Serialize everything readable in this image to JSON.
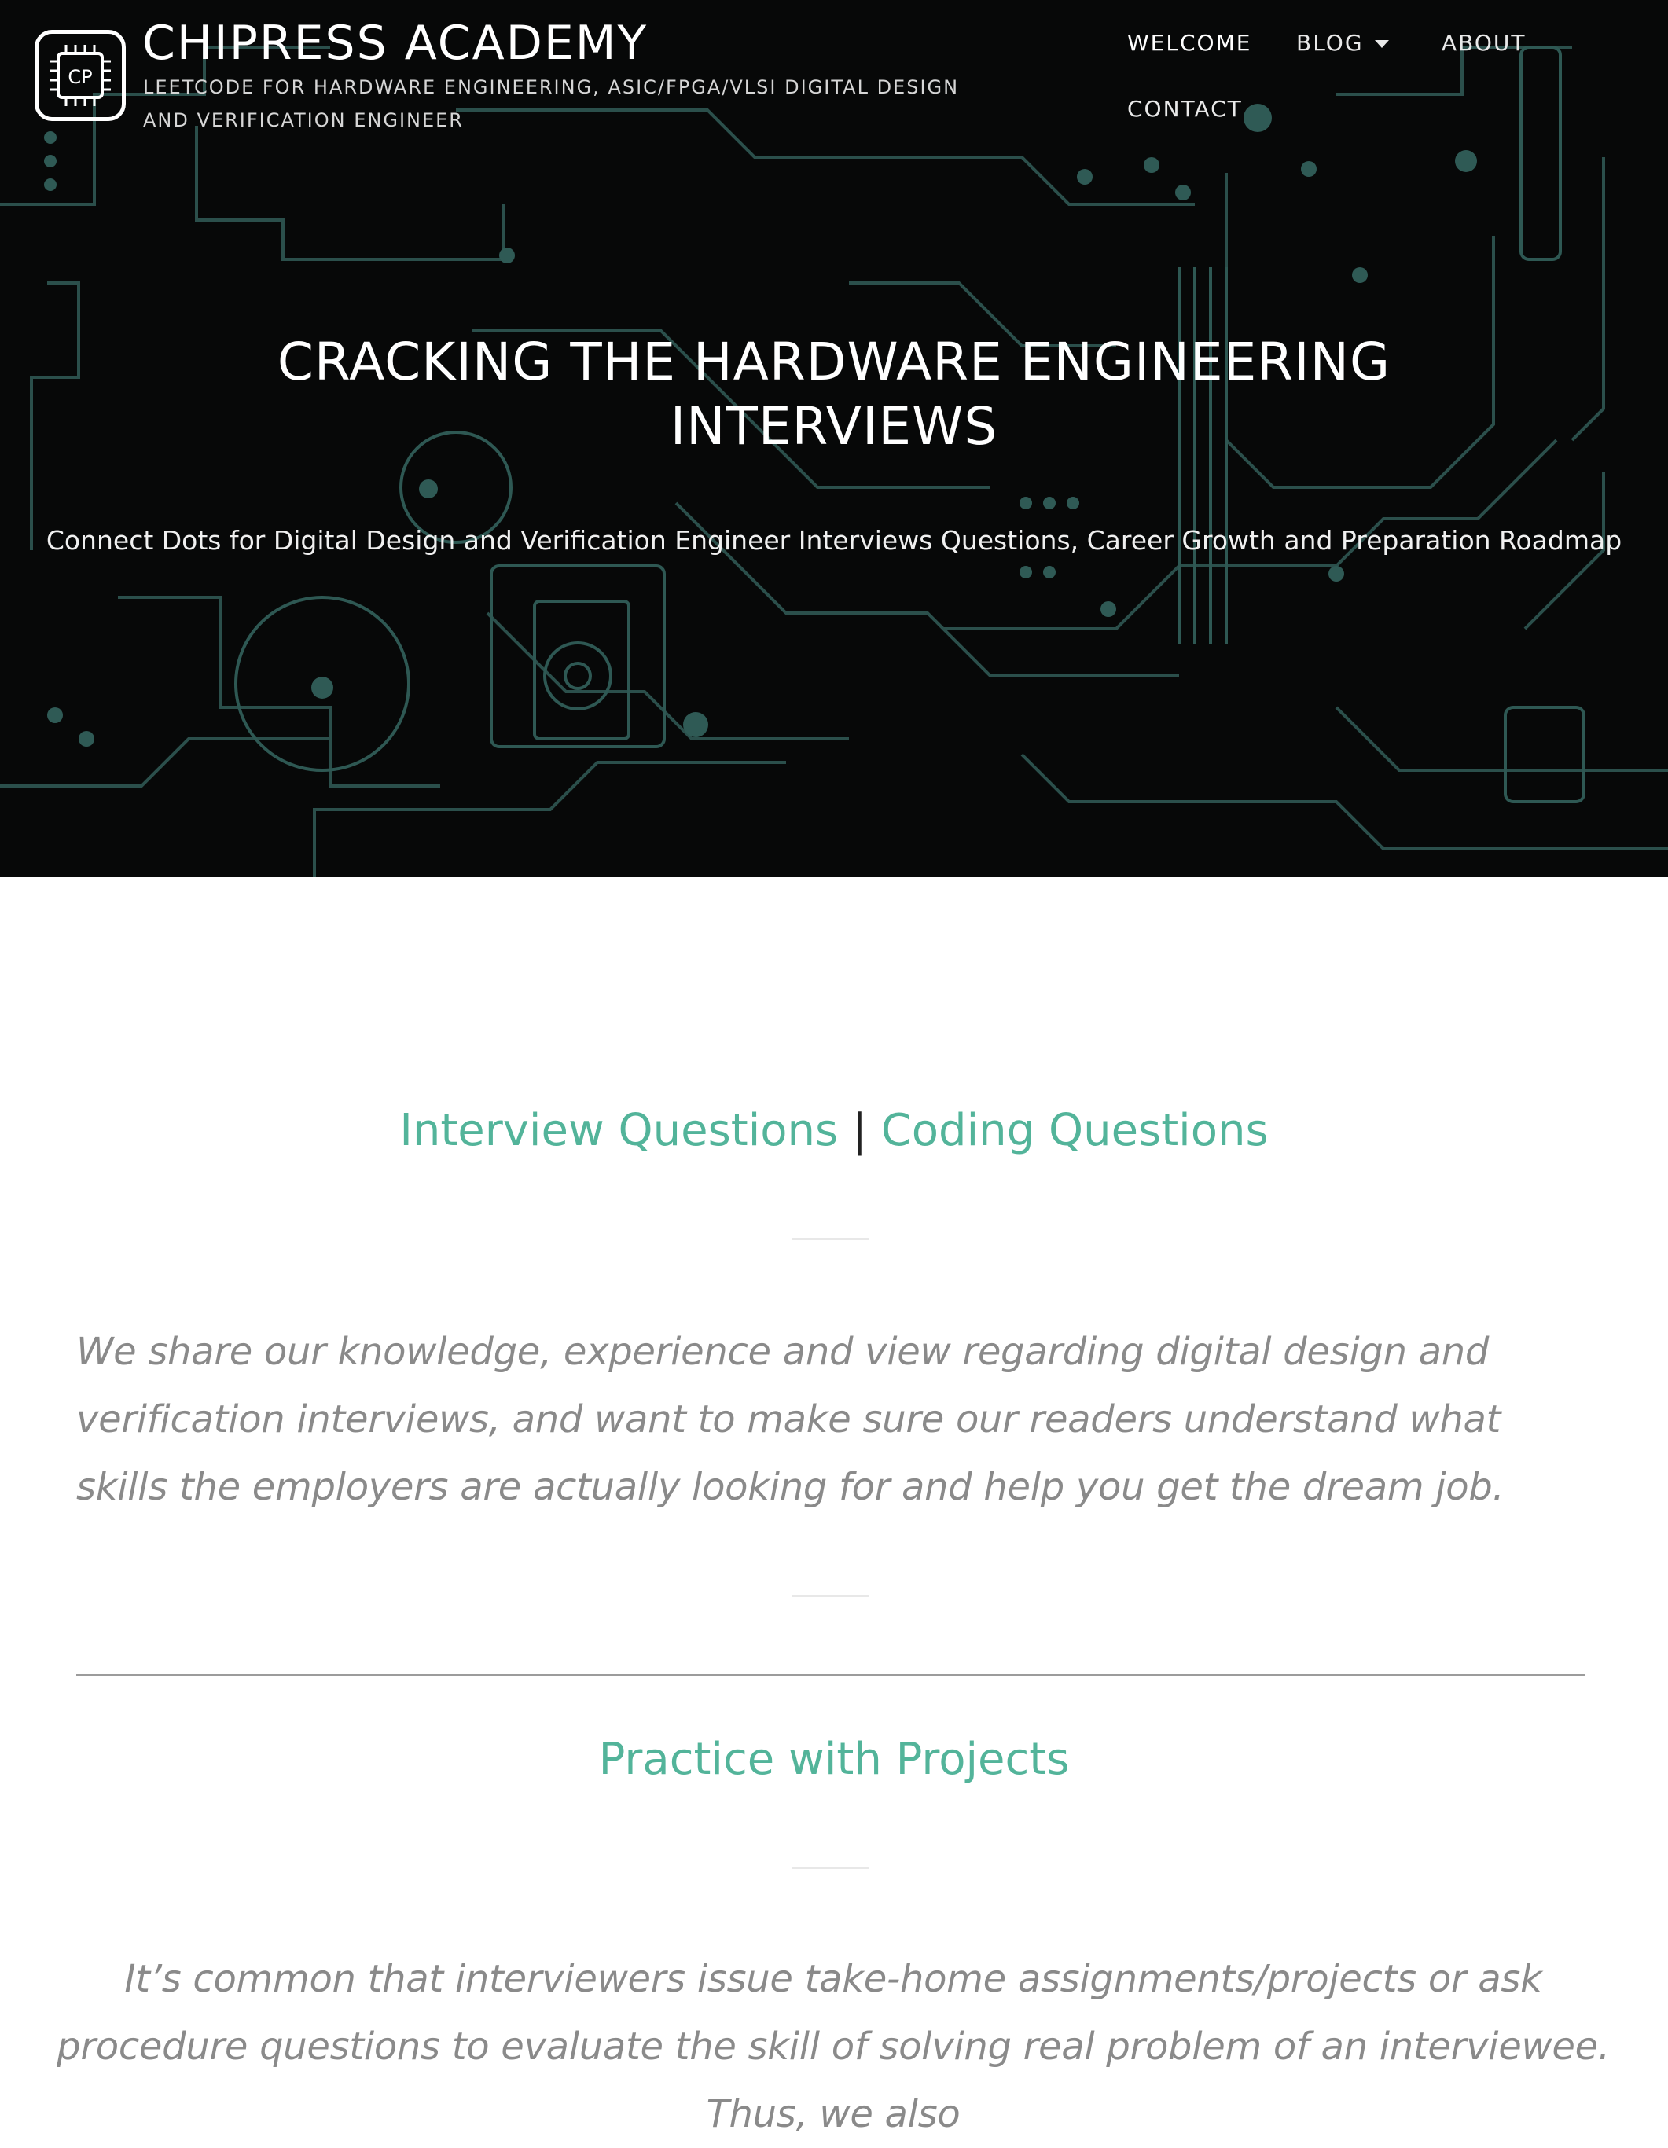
{
  "site": {
    "logo_text": "CP",
    "title": "CHIPRESS ACADEMY",
    "tagline": "LEETCODE FOR HARDWARE ENGINEERING, ASIC/FPGA/VLSI DIGITAL DESIGN AND VERIFICATION ENGINEER"
  },
  "nav": {
    "items": [
      {
        "label": "WELCOME",
        "active": true
      },
      {
        "label": "BLOG",
        "has_dropdown": true
      },
      {
        "label": "ABOUT"
      },
      {
        "label": "CONTACT"
      }
    ]
  },
  "hero": {
    "title_line1": "CRACKING THE HARDWARE ENGINEERING",
    "title_line2": "INTERVIEWS",
    "subtitle": "Connect Dots for Digital Design and Verification Engineer Interviews Questions, Career Growth and Preparation Roadmap"
  },
  "section1": {
    "link1": "Interview Questions",
    "separator": "|",
    "link2": "Coding Questions",
    "paragraph": "We share our knowledge, experience and view regarding digital design and verification interviews, and want to make sure our readers understand what skills the employers are actually looking for and help you get the dream job."
  },
  "section2": {
    "heading": "Practice with Projects",
    "paragraph": "It’s common that interviewers issue take-home assignments/projects or ask procedure questions to evaluate the skill of solving real problem of an interviewee. Thus, we also"
  },
  "colors": {
    "accent": "#53b49a",
    "hero_bg": "#070808",
    "circuit_line": "#2f5a55",
    "text_muted": "#8a8a8a"
  }
}
